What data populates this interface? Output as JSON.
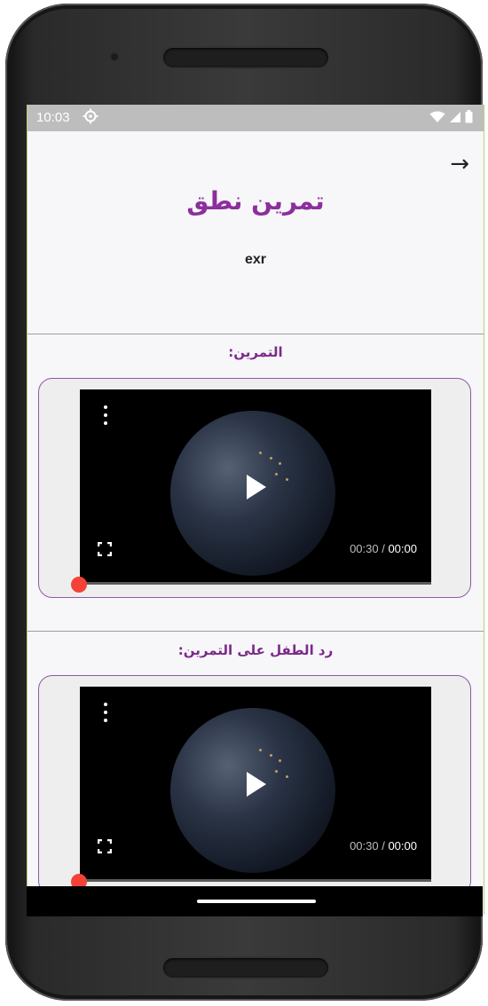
{
  "status_bar": {
    "time": "10:03",
    "gear_icon": "settings-icon",
    "wifi_icon": "wifi-icon",
    "signal_icon": "signal-icon",
    "battery_icon": "battery-icon"
  },
  "header": {
    "back_arrow": "→",
    "title": "تمرين نطق",
    "subtitle": "exr"
  },
  "sections": [
    {
      "label": "التمرين:",
      "video": {
        "time_current": "00:00",
        "time_separator": " / ",
        "time_total": "00:30",
        "progress": 0.0
      }
    },
    {
      "label": "رد الطفل على التمرين:",
      "video": {
        "time_current": "00:00",
        "time_separator": " / ",
        "time_total": "00:30",
        "progress": 0.0
      }
    }
  ],
  "colors": {
    "accent": "#8b2f9c",
    "progress_thumb": "#f44336"
  }
}
